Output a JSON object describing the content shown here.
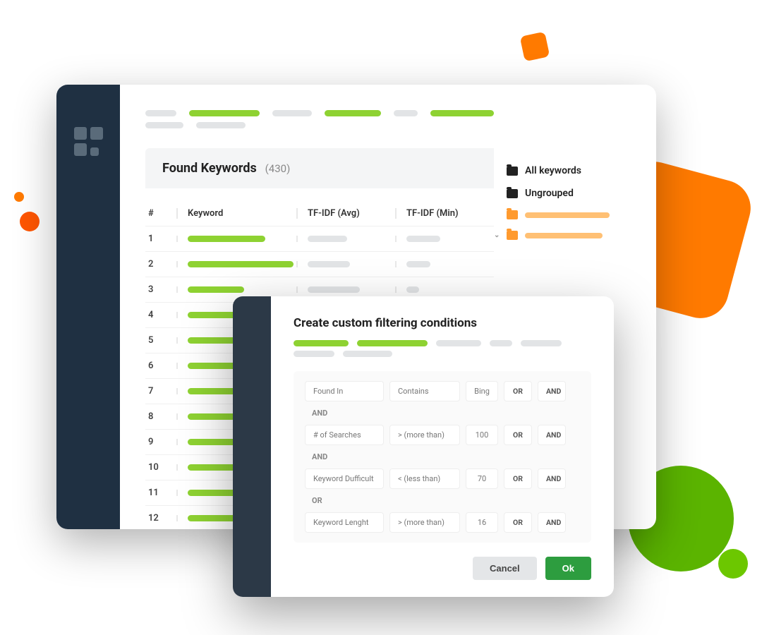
{
  "section": {
    "title": "Found Keywords",
    "count": "(430)"
  },
  "table": {
    "headers": {
      "num": "#",
      "keyword": "Keyword",
      "avg": "TF-IDF (Avg)",
      "min": "TF-IDF (Min)"
    },
    "rows": [
      {
        "n": "1",
        "kw_w": 110,
        "avg_w": 56,
        "min_w": 48
      },
      {
        "n": "2",
        "kw_w": 150,
        "avg_w": 60,
        "min_w": 34
      },
      {
        "n": "3",
        "kw_w": 80,
        "avg_w": 74,
        "min_w": 18
      },
      {
        "n": "4",
        "kw_w": 96,
        "avg_w": 0,
        "min_w": 0
      },
      {
        "n": "5",
        "kw_w": 134,
        "avg_w": 0,
        "min_w": 0
      },
      {
        "n": "6",
        "kw_w": 72,
        "avg_w": 0,
        "min_w": 0
      },
      {
        "n": "7",
        "kw_w": 110,
        "avg_w": 0,
        "min_w": 0
      },
      {
        "n": "8",
        "kw_w": 96,
        "avg_w": 0,
        "min_w": 0
      },
      {
        "n": "9",
        "kw_w": 88,
        "avg_w": 0,
        "min_w": 0
      },
      {
        "n": "10",
        "kw_w": 120,
        "avg_w": 0,
        "min_w": 0
      },
      {
        "n": "11",
        "kw_w": 100,
        "avg_w": 0,
        "min_w": 0
      },
      {
        "n": "12",
        "kw_w": 90,
        "avg_w": 0,
        "min_w": 0
      }
    ]
  },
  "groups": {
    "all": "All keywords",
    "ungrouped": "Ungrouped"
  },
  "modal": {
    "title": "Create custom filtering conditions",
    "rows": [
      {
        "field": "Found In",
        "op": "Contains",
        "val": "Bing",
        "j1": "OR",
        "j2": "AND",
        "after": "AND"
      },
      {
        "field": "# of Searches",
        "op": "> (more than)",
        "val": "100",
        "j1": "OR",
        "j2": "AND",
        "after": "AND"
      },
      {
        "field": "Keyword Dufficult",
        "op": "< (less than)",
        "val": "70",
        "j1": "OR",
        "j2": "AND",
        "after": "OR"
      },
      {
        "field": "Keyword Lenght",
        "op": "> (more than)",
        "val": "16",
        "j1": "OR",
        "j2": "AND",
        "after": ""
      }
    ],
    "cancel": "Cancel",
    "ok": "Ok"
  }
}
